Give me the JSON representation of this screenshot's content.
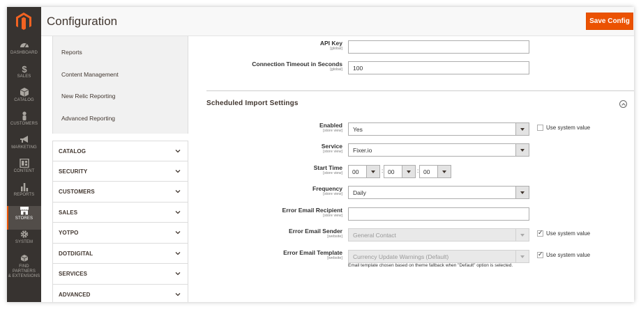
{
  "header": {
    "title": "Configuration",
    "save_label": "Save Config"
  },
  "menu": {
    "items": [
      {
        "label": "DASHBOARD",
        "icon": "dashboard-icon"
      },
      {
        "label": "SALES",
        "icon": "dollar-icon"
      },
      {
        "label": "CATALOG",
        "icon": "box-icon"
      },
      {
        "label": "CUSTOMERS",
        "icon": "person-icon"
      },
      {
        "label": "MARKETING",
        "icon": "megaphone-icon"
      },
      {
        "label": "CONTENT",
        "icon": "layout-icon"
      },
      {
        "label": "REPORTS",
        "icon": "bar-chart-icon"
      },
      {
        "label": "STORES",
        "icon": "store-icon"
      },
      {
        "label": "SYSTEM",
        "icon": "gear-icon"
      },
      {
        "label": "FIND PARTNERS",
        "label2": "& EXTENSIONS",
        "icon": "cubes-icon"
      }
    ]
  },
  "tabs": {
    "subnav": [
      "Reports",
      "Content Management",
      "New Relic Reporting",
      "Advanced Reporting"
    ],
    "groups": [
      "CATALOG",
      "SECURITY",
      "CUSTOMERS",
      "SALES",
      "YOTPO",
      "DOTDIGITAL",
      "SERVICES",
      "ADVANCED"
    ]
  },
  "fields": {
    "api_key": {
      "label": "API Key",
      "scope": "[global]",
      "value": ""
    },
    "timeout": {
      "label": "Connection Timeout in Seconds",
      "scope": "[global]",
      "value": "100"
    },
    "section_title": "Scheduled Import Settings",
    "enabled": {
      "label": "Enabled",
      "scope": "[store view]",
      "value": "Yes",
      "use_system": "Use system value"
    },
    "service": {
      "label": "Service",
      "scope": "[store view]",
      "value": "Fixer.io"
    },
    "start_time": {
      "label": "Start Time",
      "scope": "[store view]",
      "hour": "00",
      "minute": "00",
      "second": "00",
      "sep": ":"
    },
    "frequency": {
      "label": "Frequency",
      "scope": "[store view]",
      "value": "Daily"
    },
    "error_recipient": {
      "label": "Error Email Recipient",
      "scope": "[store view]",
      "value": ""
    },
    "error_sender": {
      "label": "Error Email Sender",
      "scope": "[website]",
      "value": "General Contact",
      "use_system": "Use system value"
    },
    "error_template": {
      "label": "Error Email Template",
      "scope": "[website]",
      "value": "Currency Update Warnings (Default)",
      "use_system": "Use system value",
      "note": "Email template chosen based on theme fallback when \"Default\" option is selected."
    }
  },
  "colors": {
    "accent": "#eb5202",
    "menu_bg": "#373330"
  }
}
